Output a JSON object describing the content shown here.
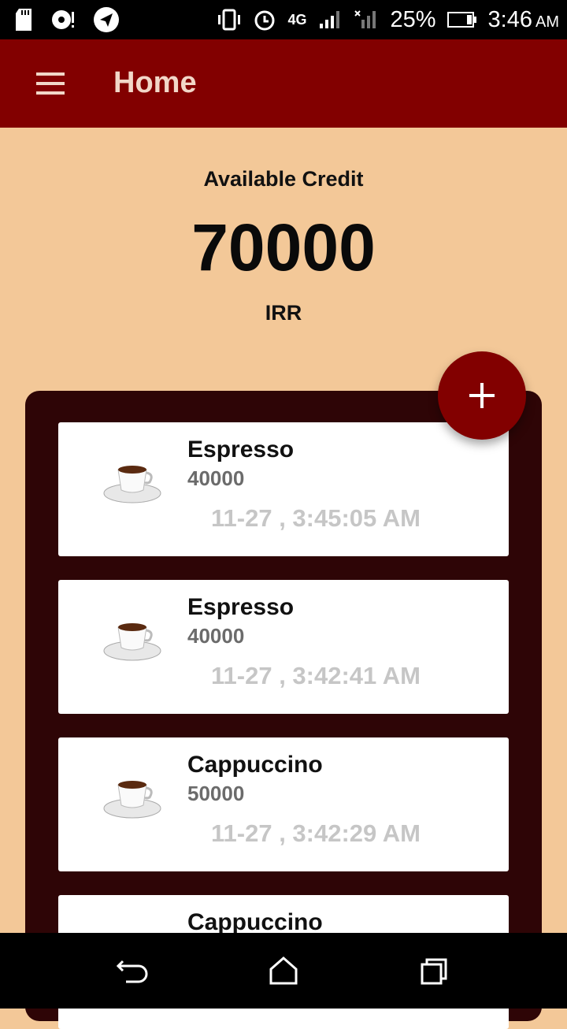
{
  "status_bar": {
    "battery": "25%",
    "time": "3:46",
    "ampm": "AM",
    "network": "4G"
  },
  "appbar": {
    "title": "Home"
  },
  "credit": {
    "label": "Available Credit",
    "amount": "70000",
    "currency": "IRR"
  },
  "transactions": [
    {
      "name": "Espresso",
      "price": "40000",
      "time": "11-27 , 3:45:05 AM"
    },
    {
      "name": "Espresso",
      "price": "40000",
      "time": "11-27 , 3:42:41 AM"
    },
    {
      "name": "Cappuccino",
      "price": "50000",
      "time": "11-27 , 3:42:29 AM"
    },
    {
      "name": "Cappuccino",
      "price": "",
      "time": ""
    }
  ],
  "colors": {
    "primary": "#820000",
    "background": "#f3c898",
    "panel": "#2e0506"
  },
  "icons": {
    "menu": "hamburger-icon",
    "add": "plus-icon",
    "cup": "coffee-cup-icon"
  }
}
